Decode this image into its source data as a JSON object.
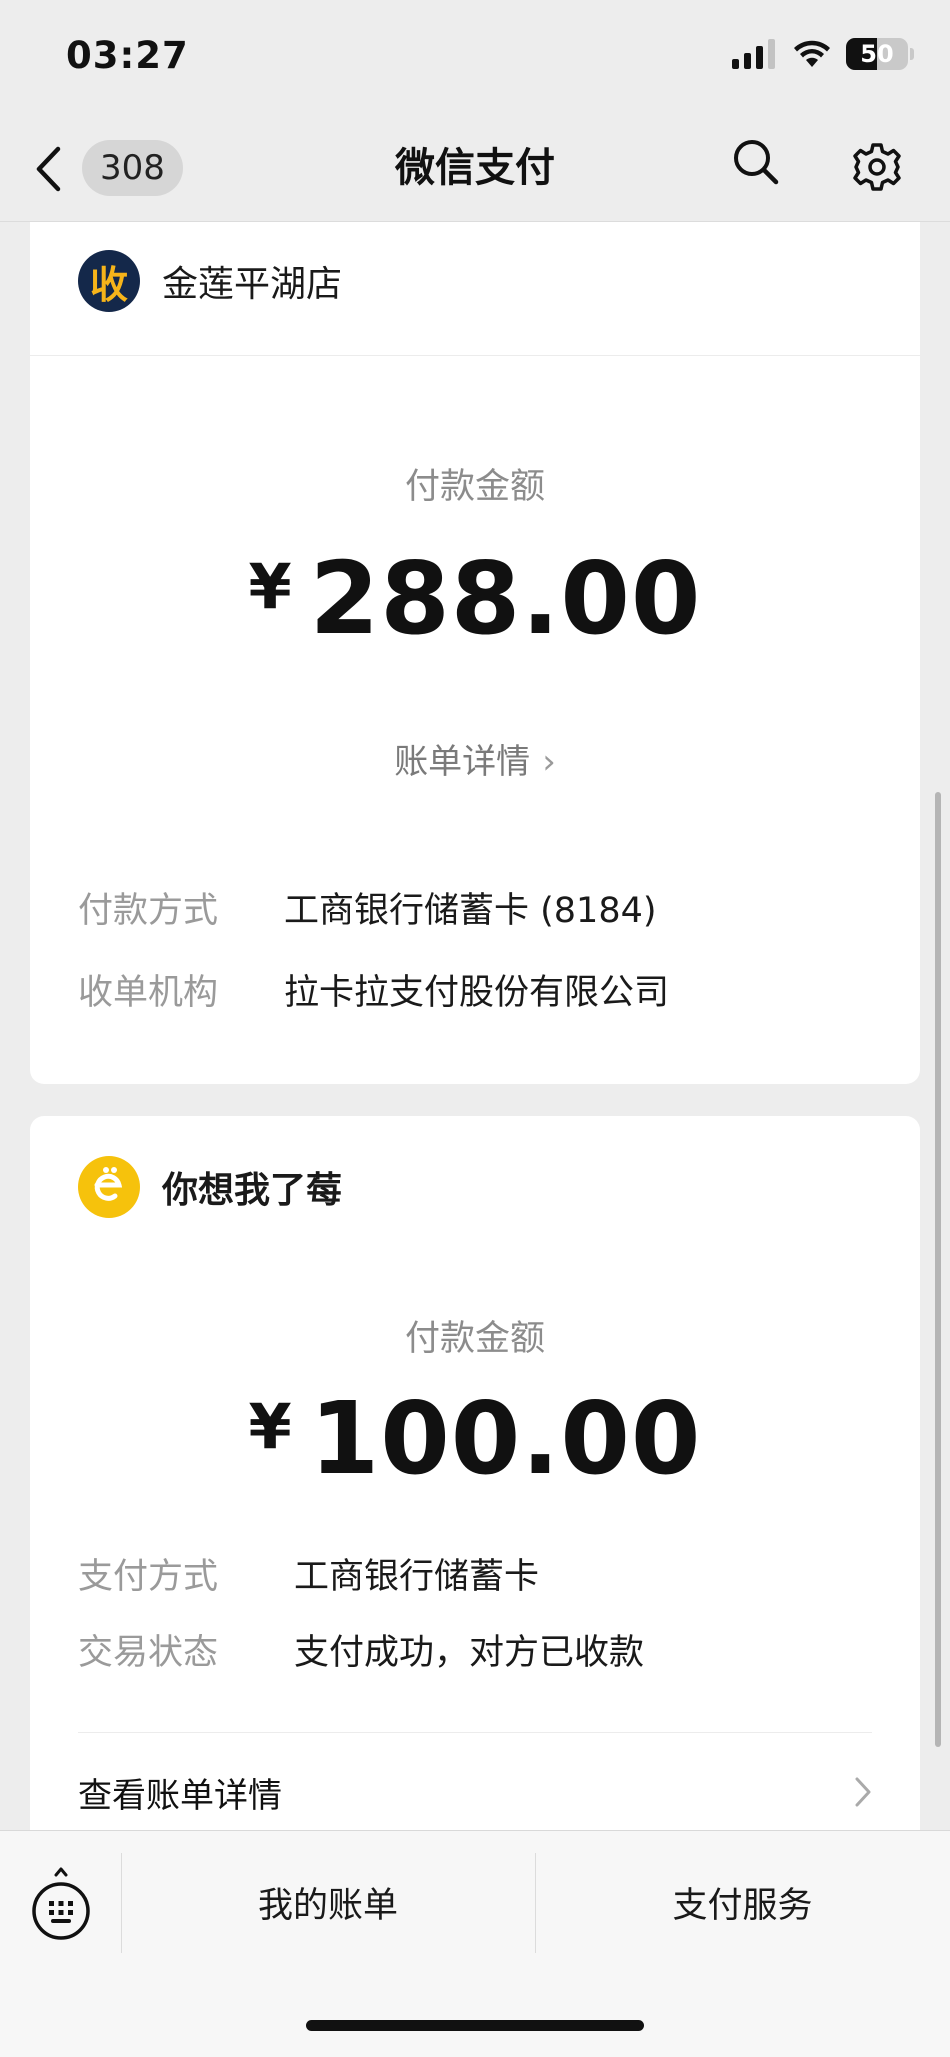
{
  "status": {
    "time": "03:27",
    "battery": "50",
    "battery_level": 0.5
  },
  "nav": {
    "count": "308",
    "title": "微信支付"
  },
  "payment1": {
    "logo_char": "收",
    "merchant": "金莲平湖店",
    "amount_label": "付款金额",
    "currency": "¥",
    "amount": "288.00",
    "bill_link": "账单详情",
    "rows": [
      {
        "label": "付款方式",
        "value": "工商银行储蓄卡 (8184)"
      },
      {
        "label": "收单机构",
        "value": "拉卡拉支付股份有限公司"
      }
    ]
  },
  "payment2": {
    "merchant": "你想我了莓",
    "amount_label": "付款金额",
    "currency": "¥",
    "amount": "100.00",
    "rows": [
      {
        "label": "支付方式",
        "value": "工商银行储蓄卡"
      },
      {
        "label": "交易状态",
        "value": "支付成功，对方已收款"
      }
    ],
    "detail_link": "查看账单详情"
  },
  "tabbar": {
    "tabs": [
      "我的账单",
      "支付服务"
    ]
  },
  "colors": {
    "accent_yellow": "#f6c20c",
    "logo_navy": "#14284a"
  }
}
